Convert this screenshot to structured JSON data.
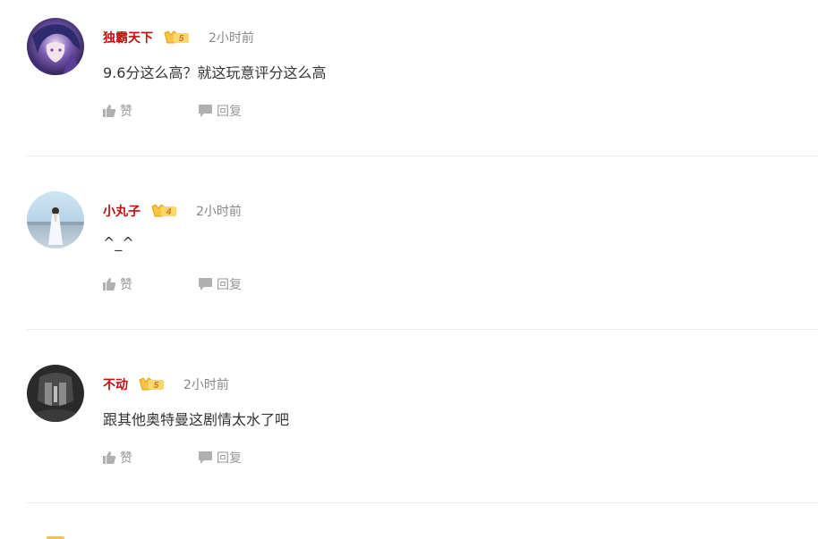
{
  "comments": [
    {
      "username": "独霸天下",
      "vip_level": "5",
      "time": "2小时前",
      "content": "9.6分这么高？就这玩意评分这么高",
      "like_label": "赞",
      "reply_label": "回复",
      "avatar_description": "anime-character-avatar"
    },
    {
      "username": "小丸子",
      "vip_level": "4",
      "time": "2小时前",
      "content": "^_^",
      "like_label": "赞",
      "reply_label": "回复",
      "avatar_description": "photo-avatar"
    },
    {
      "username": "不动",
      "vip_level": "5",
      "time": "2小时前",
      "content": "跟其他奥特曼这剧情太水了吧",
      "like_label": "赞",
      "reply_label": "回复",
      "avatar_description": "dark-avatar"
    }
  ],
  "colors": {
    "username": "#c40e0e",
    "meta_text": "#888888",
    "content_text": "#333333",
    "action_text": "#999999",
    "divider": "#ececec",
    "vip_gold": "#f0b429"
  },
  "icons": {
    "like": "thumbs-up-icon",
    "reply": "speech-bubble-icon",
    "vip": "vip-crown-badge-icon"
  }
}
